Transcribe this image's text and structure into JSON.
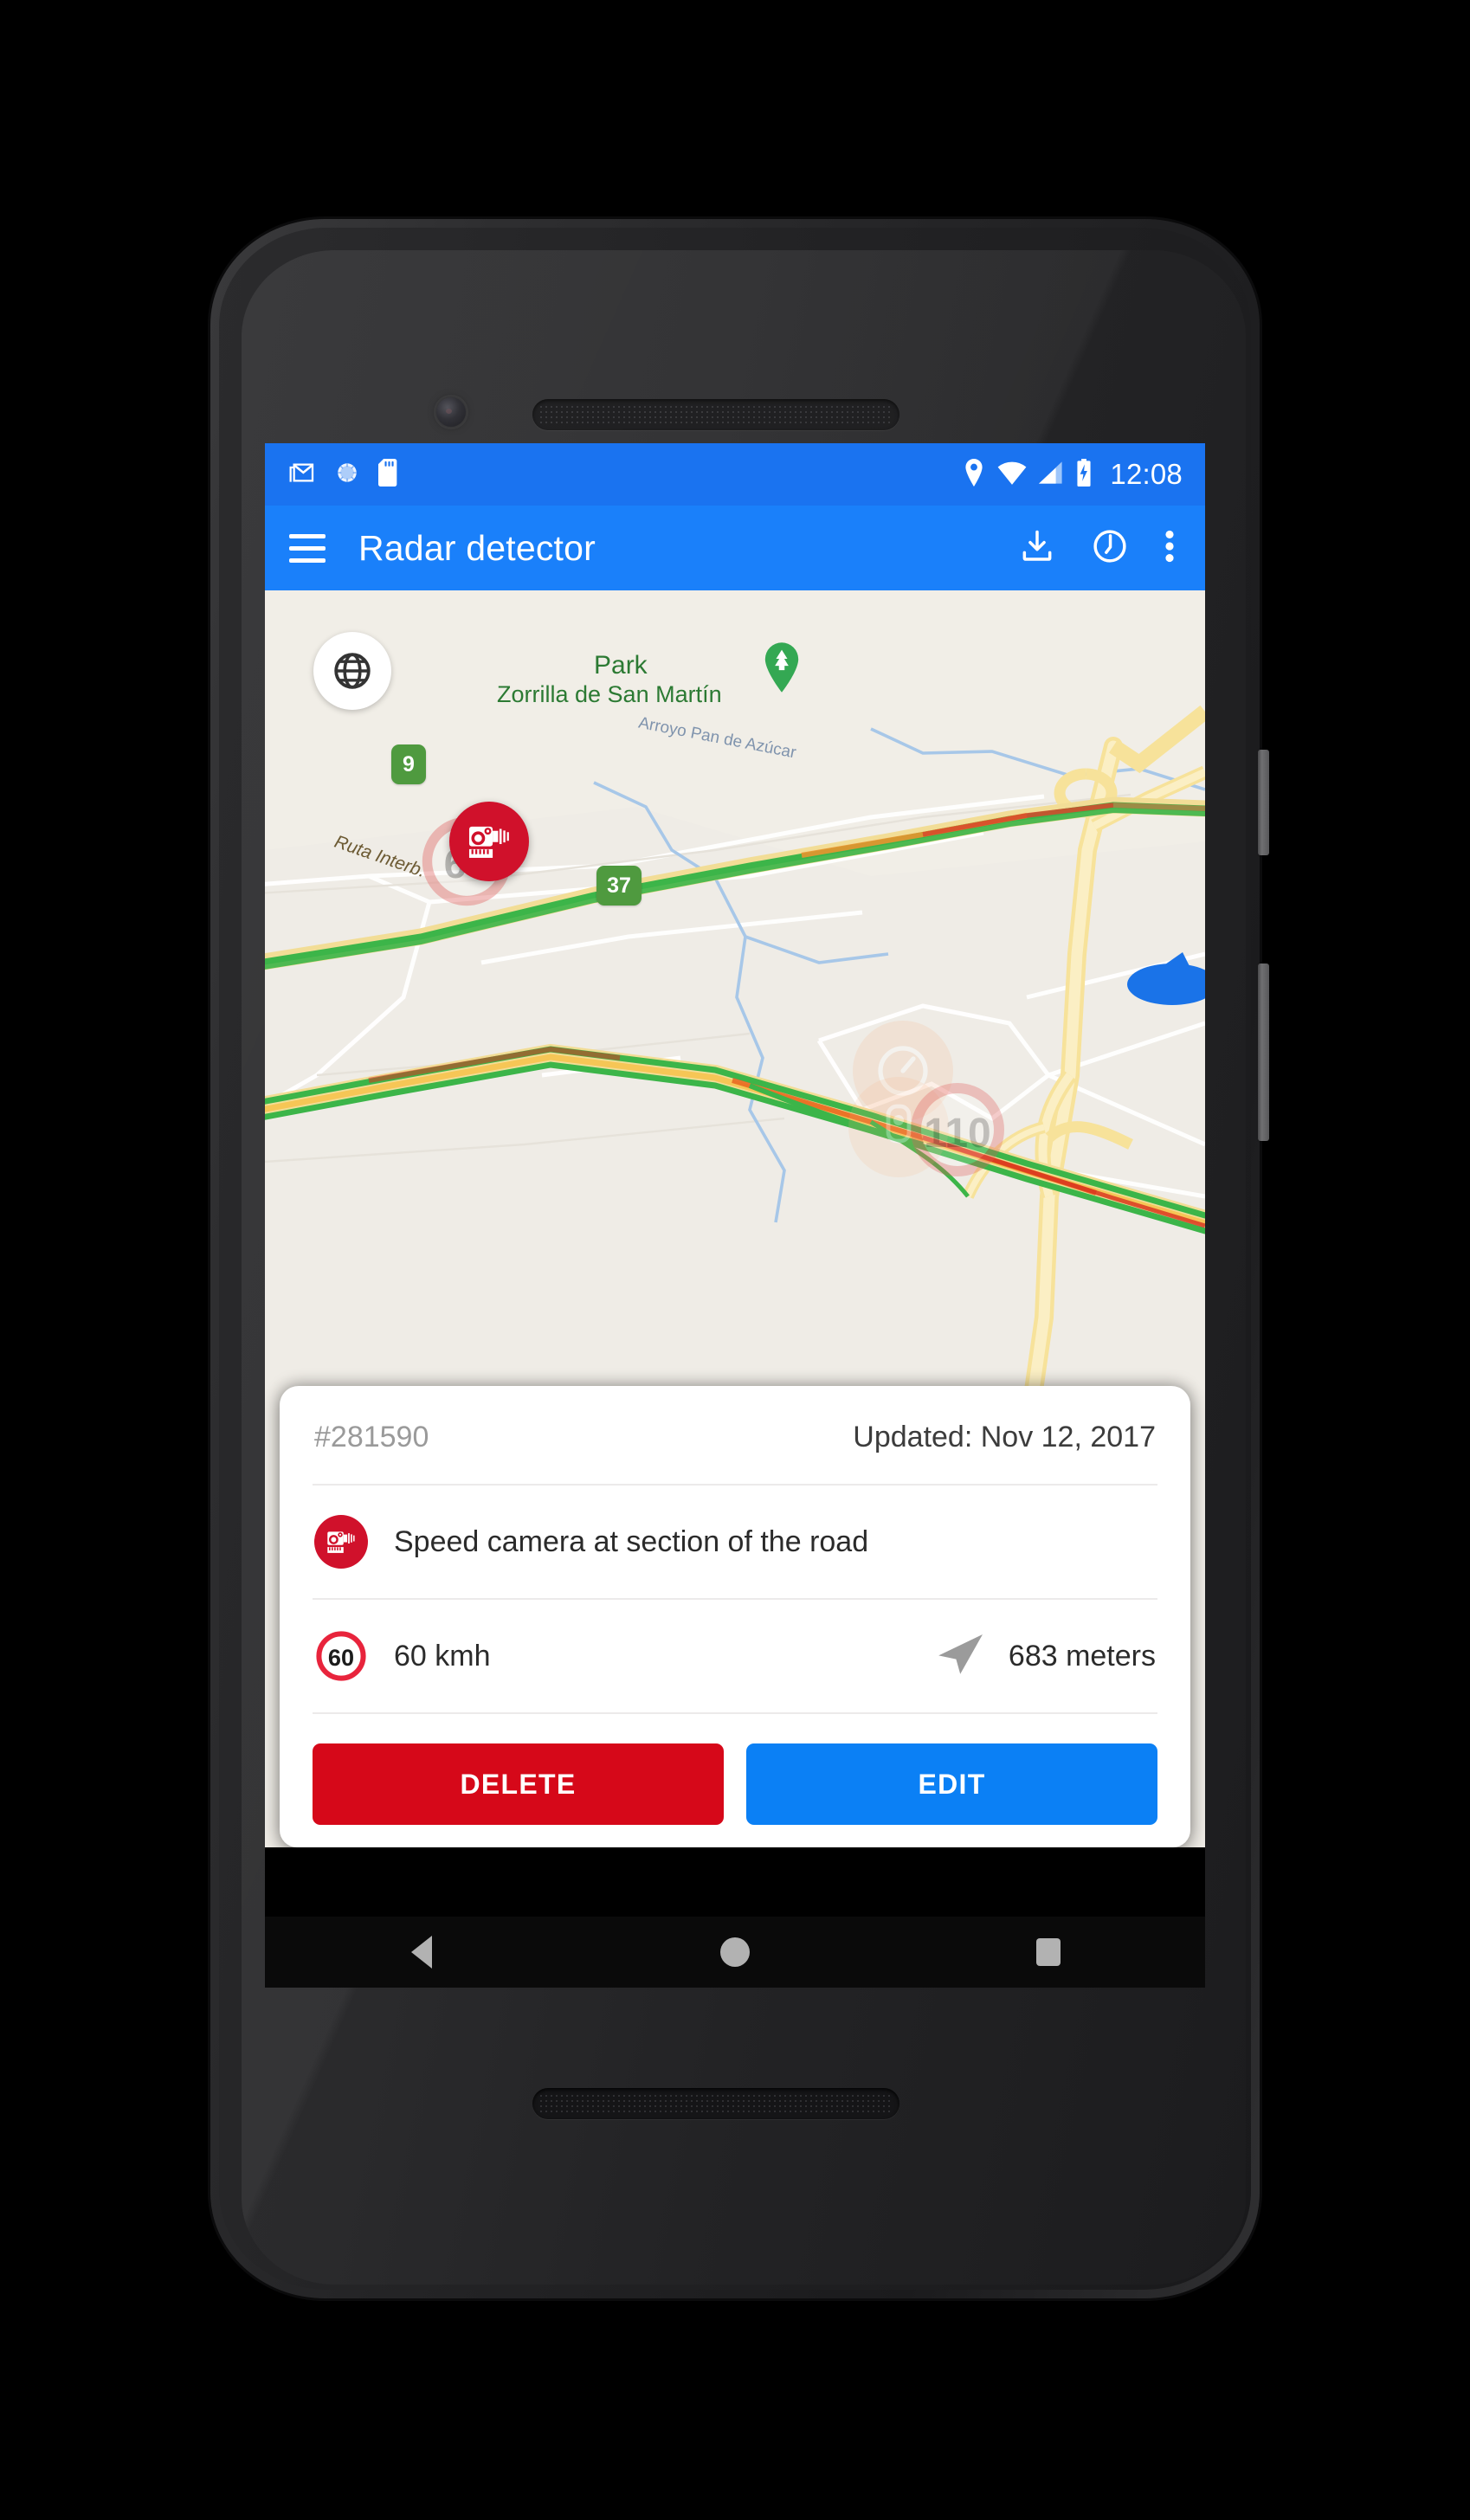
{
  "status_bar": {
    "time": "12:08",
    "left_icons": [
      "gmail-icon",
      "sync-icon",
      "sd-card-icon"
    ],
    "right_icons": [
      "location-icon",
      "wifi-icon",
      "cellular-signal-icon",
      "battery-charging-icon"
    ],
    "background_color": "#1a73f0"
  },
  "app_bar": {
    "title": "Radar detector",
    "menu_icon": "hamburger-menu-icon",
    "actions": [
      "download-icon",
      "history-clock-icon",
      "overflow-menu-icon"
    ],
    "background_color": "#1a80fa"
  },
  "map": {
    "layer_button_icon": "globe-icon",
    "selected_marker_icon": "speed-camera-icon",
    "labels": {
      "park_name": "Park",
      "park_subtitle": "Zorrilla de San Martín",
      "stream": "Arroyo Pan de Azúcar",
      "road_name": "Ruta Interb."
    },
    "route_shields": [
      "9",
      "37"
    ],
    "faded_markers": [
      "110",
      "speedometer-icon",
      "traffic-light-icon",
      "60"
    ],
    "background_color": "#f1eee7"
  },
  "detail_card": {
    "record_id": "#281590",
    "updated": "Updated: Nov 12, 2017",
    "type_row": {
      "icon": "speed-camera-icon",
      "label": "Speed camera at section of the road"
    },
    "speed_row": {
      "icon": "speed-limit-60-icon",
      "limit": "60 kmh",
      "direction_icon": "navigation-arrow-icon",
      "distance": "683 meters"
    },
    "buttons": {
      "delete": "DELETE",
      "edit": "EDIT"
    },
    "colors": {
      "delete": "#d60819",
      "edit": "#0b80f5",
      "marker_red": "#d0112b"
    }
  },
  "nav_bar": {
    "back": "back-button",
    "home": "home-button",
    "recents": "recents-button"
  }
}
